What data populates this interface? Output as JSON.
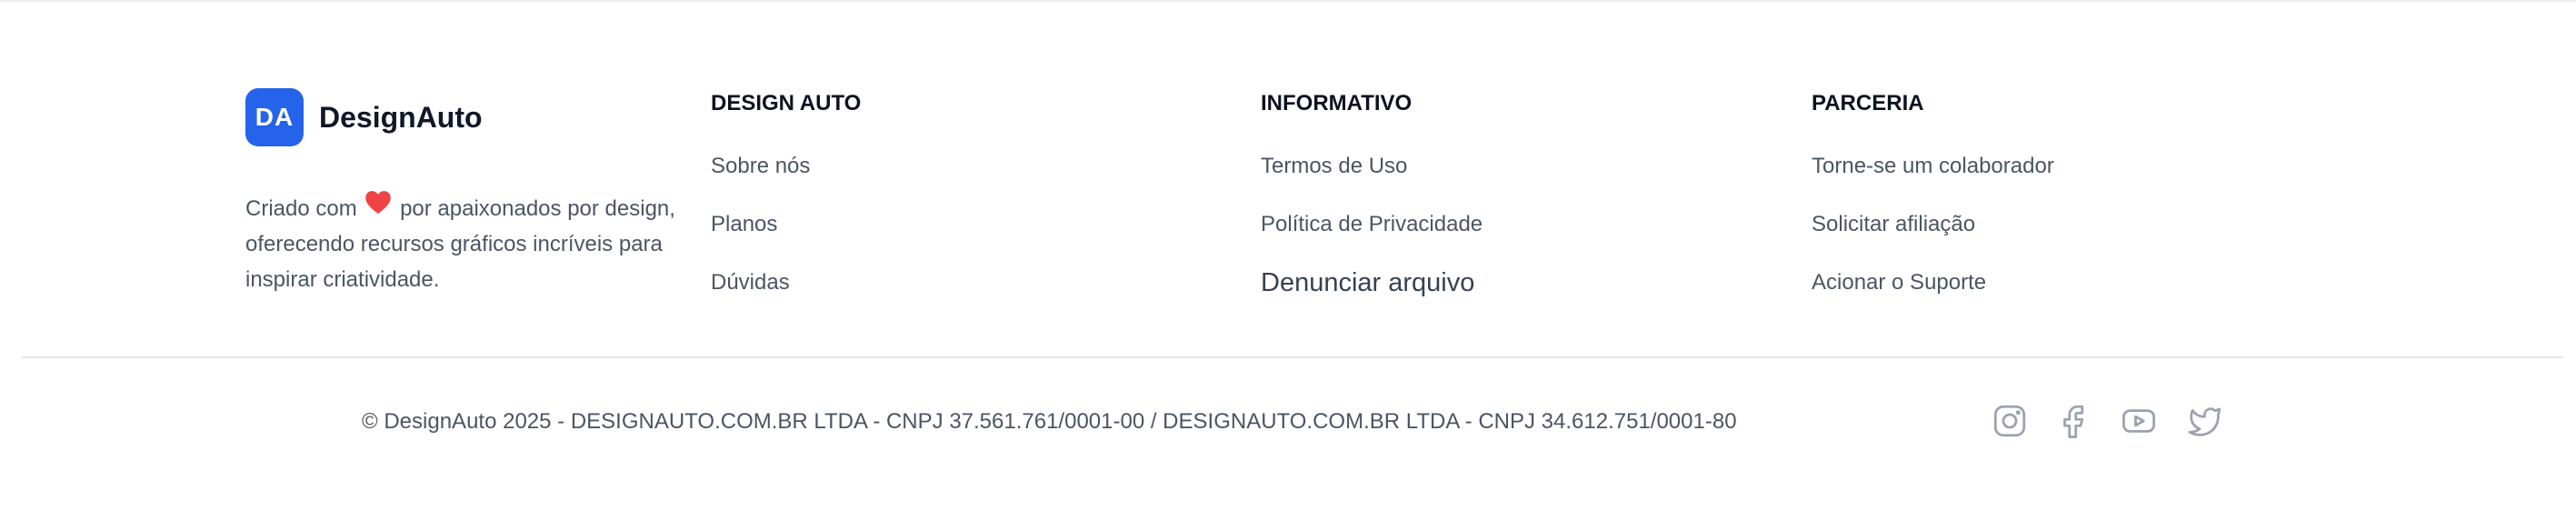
{
  "brand": {
    "logo_text": "DA",
    "name": "DesignAuto",
    "tagline_before": "Criado com",
    "tagline_after": "por apaixonados por design, oferecendo recursos gráficos incríveis para inspirar criatividade.",
    "accent_color": "#2563eb",
    "heart_icon": "heart-icon",
    "heart_color": "#ef4444"
  },
  "columns": [
    {
      "title": "DESIGN AUTO",
      "links": [
        "Sobre nós",
        "Planos",
        "Dúvidas"
      ]
    },
    {
      "title": "INFORMATIVO",
      "links": [
        "Termos de Uso",
        "Política de Privacidade",
        "Denunciar arquivo"
      ]
    },
    {
      "title": "PARCERIA",
      "links": [
        "Torne-se um colaborador",
        "Solicitar afiliação",
        "Acionar o Suporte"
      ]
    }
  ],
  "footer": {
    "copyright": "© DesignAuto 2025 - DESIGNAUTO.COM.BR LTDA - CNPJ 37.561.761/0001-00 / DESIGNAUTO.COM.BR LTDA - CNPJ 34.612.751/0001-80",
    "social": [
      "instagram-icon",
      "facebook-icon",
      "youtube-icon",
      "twitter-icon"
    ],
    "social_color": "#9ca3af"
  }
}
